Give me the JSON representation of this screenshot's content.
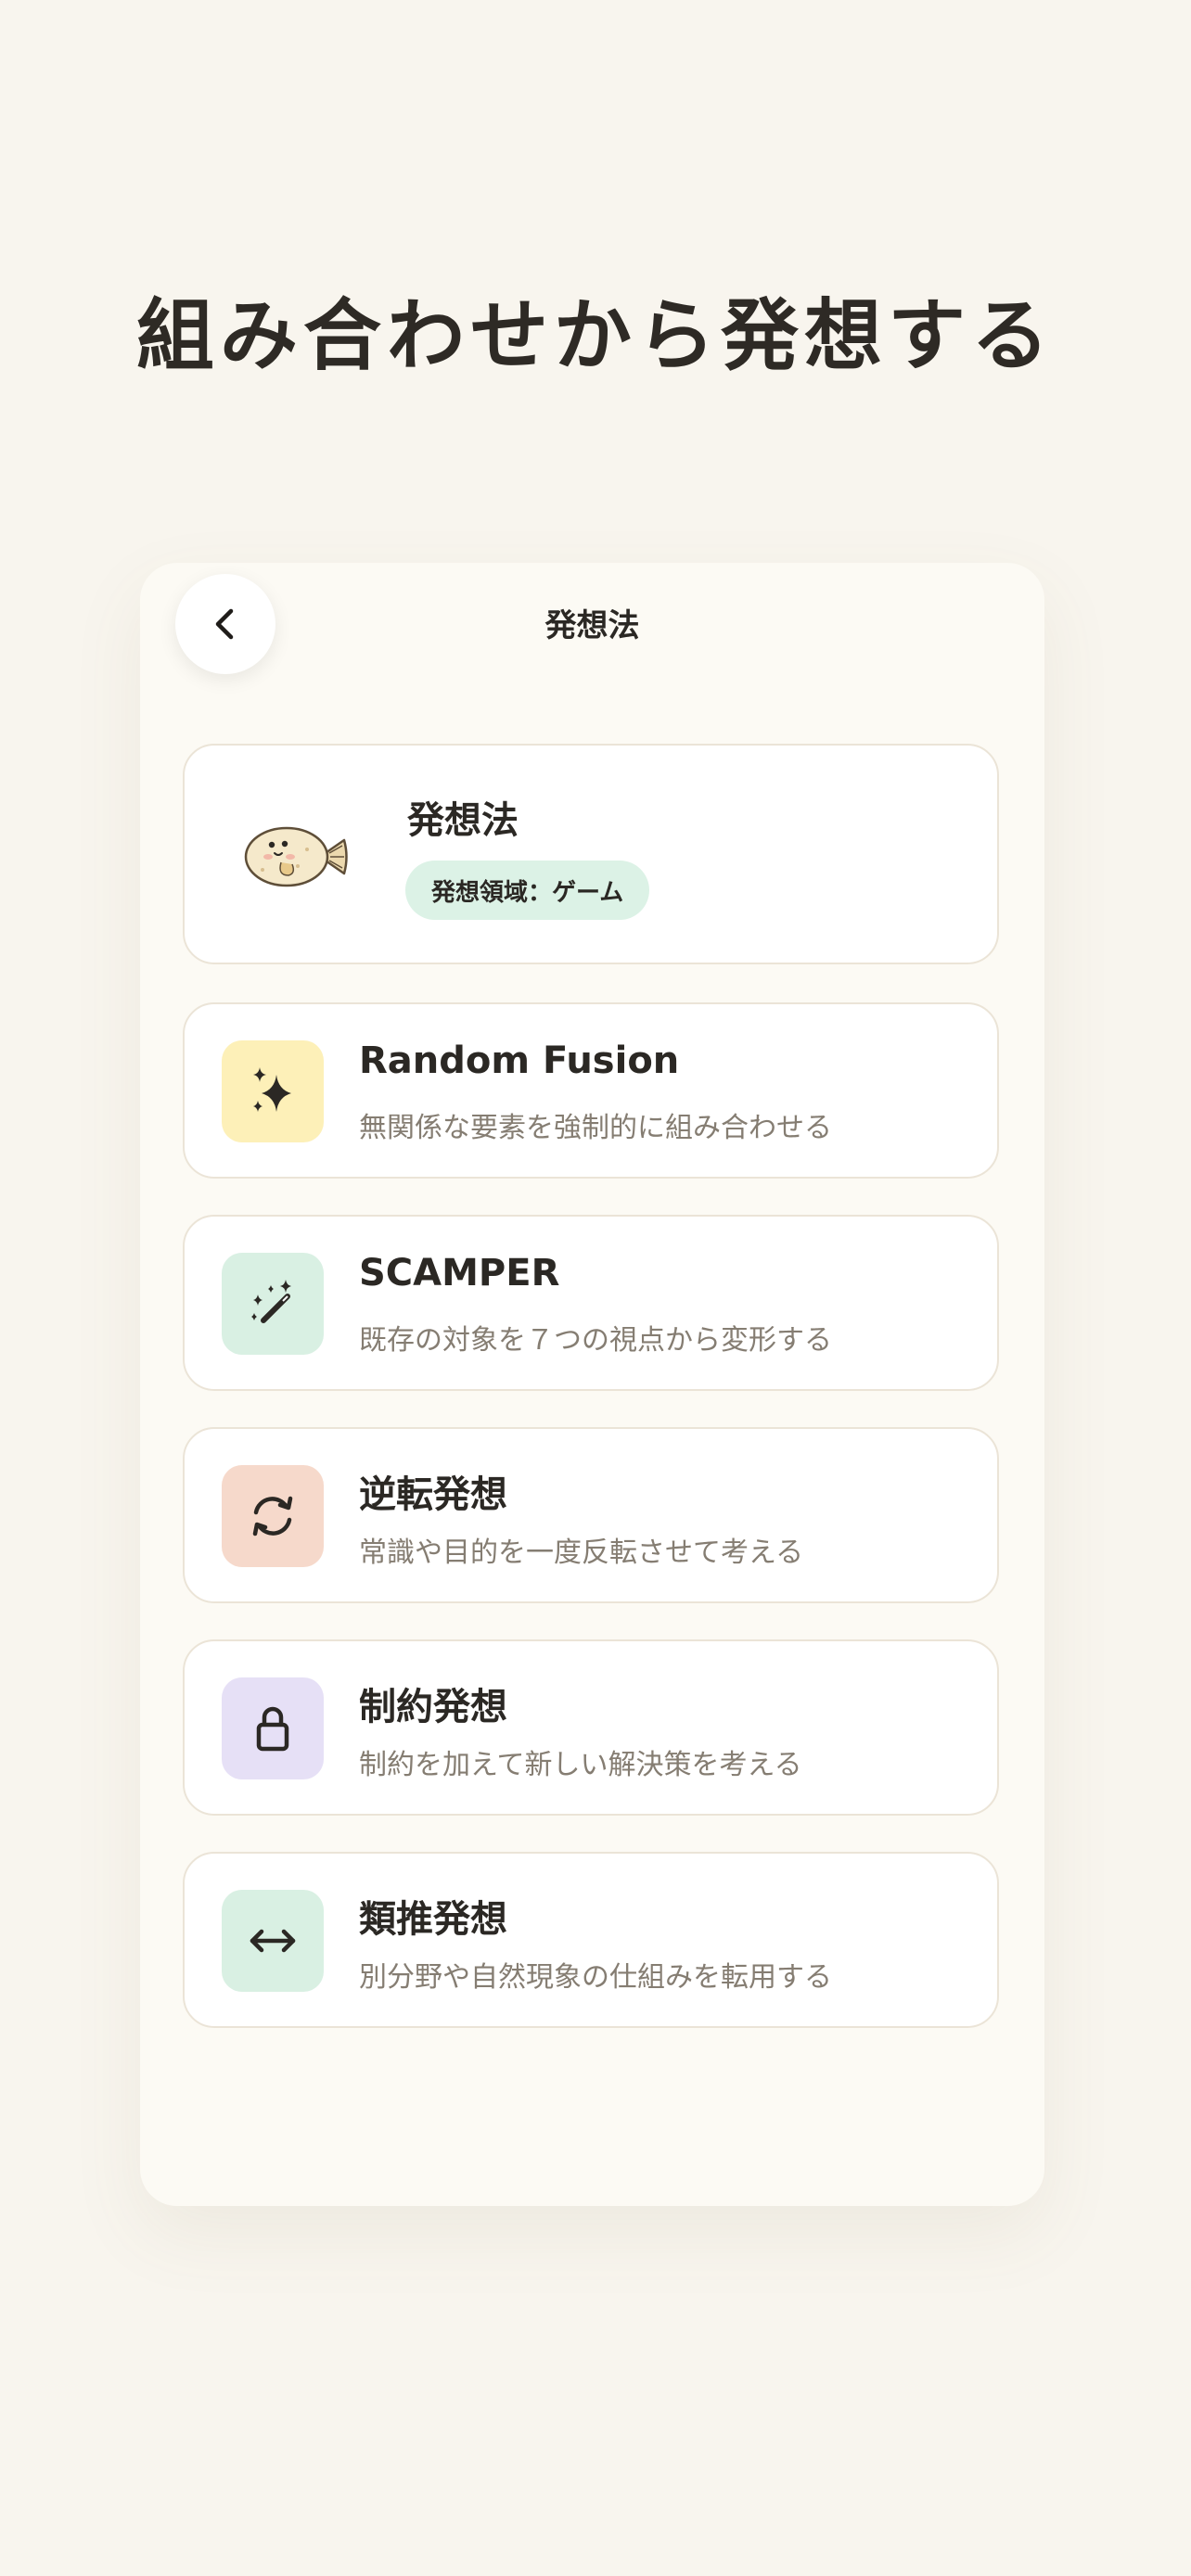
{
  "headline": "組み合わせから発想する",
  "screen": {
    "title": "発想法",
    "back_icon": "chevron-left-icon"
  },
  "profile": {
    "name": "発想法",
    "domain_chip": "発想領域：ゲーム",
    "mascot_icon": "flatfish-mascot"
  },
  "methods": [
    {
      "title": "Random Fusion",
      "desc": "無関係な要素を強制的に組み合わせる",
      "icon": "sparkles-icon",
      "icon_bg": "#fdf0b8"
    },
    {
      "title": "SCAMPER",
      "desc": "既存の対象を７つの視点から変形する",
      "icon": "magic-wand-icon",
      "icon_bg": "#d9f0e3"
    },
    {
      "title": "逆転発想",
      "desc": "常識や目的を一度反転させて考える",
      "icon": "refresh-icon",
      "icon_bg": "#f6d9cb"
    },
    {
      "title": "制約発想",
      "desc": "制約を加えて新しい解決策を考える",
      "icon": "lock-icon",
      "icon_bg": "#e6e0f6"
    },
    {
      "title": "類推発想",
      "desc": "別分野や自然現象の仕組みを転用する",
      "icon": "arrows-horizontal-icon",
      "icon_bg": "#d9f0e3"
    }
  ],
  "colors": {
    "page_bg": "#f8f5ee",
    "card_bg": "#ffffff",
    "chip_bg": "#dcf2e6",
    "text_primary": "#2b2824",
    "text_secondary": "#857d72"
  }
}
